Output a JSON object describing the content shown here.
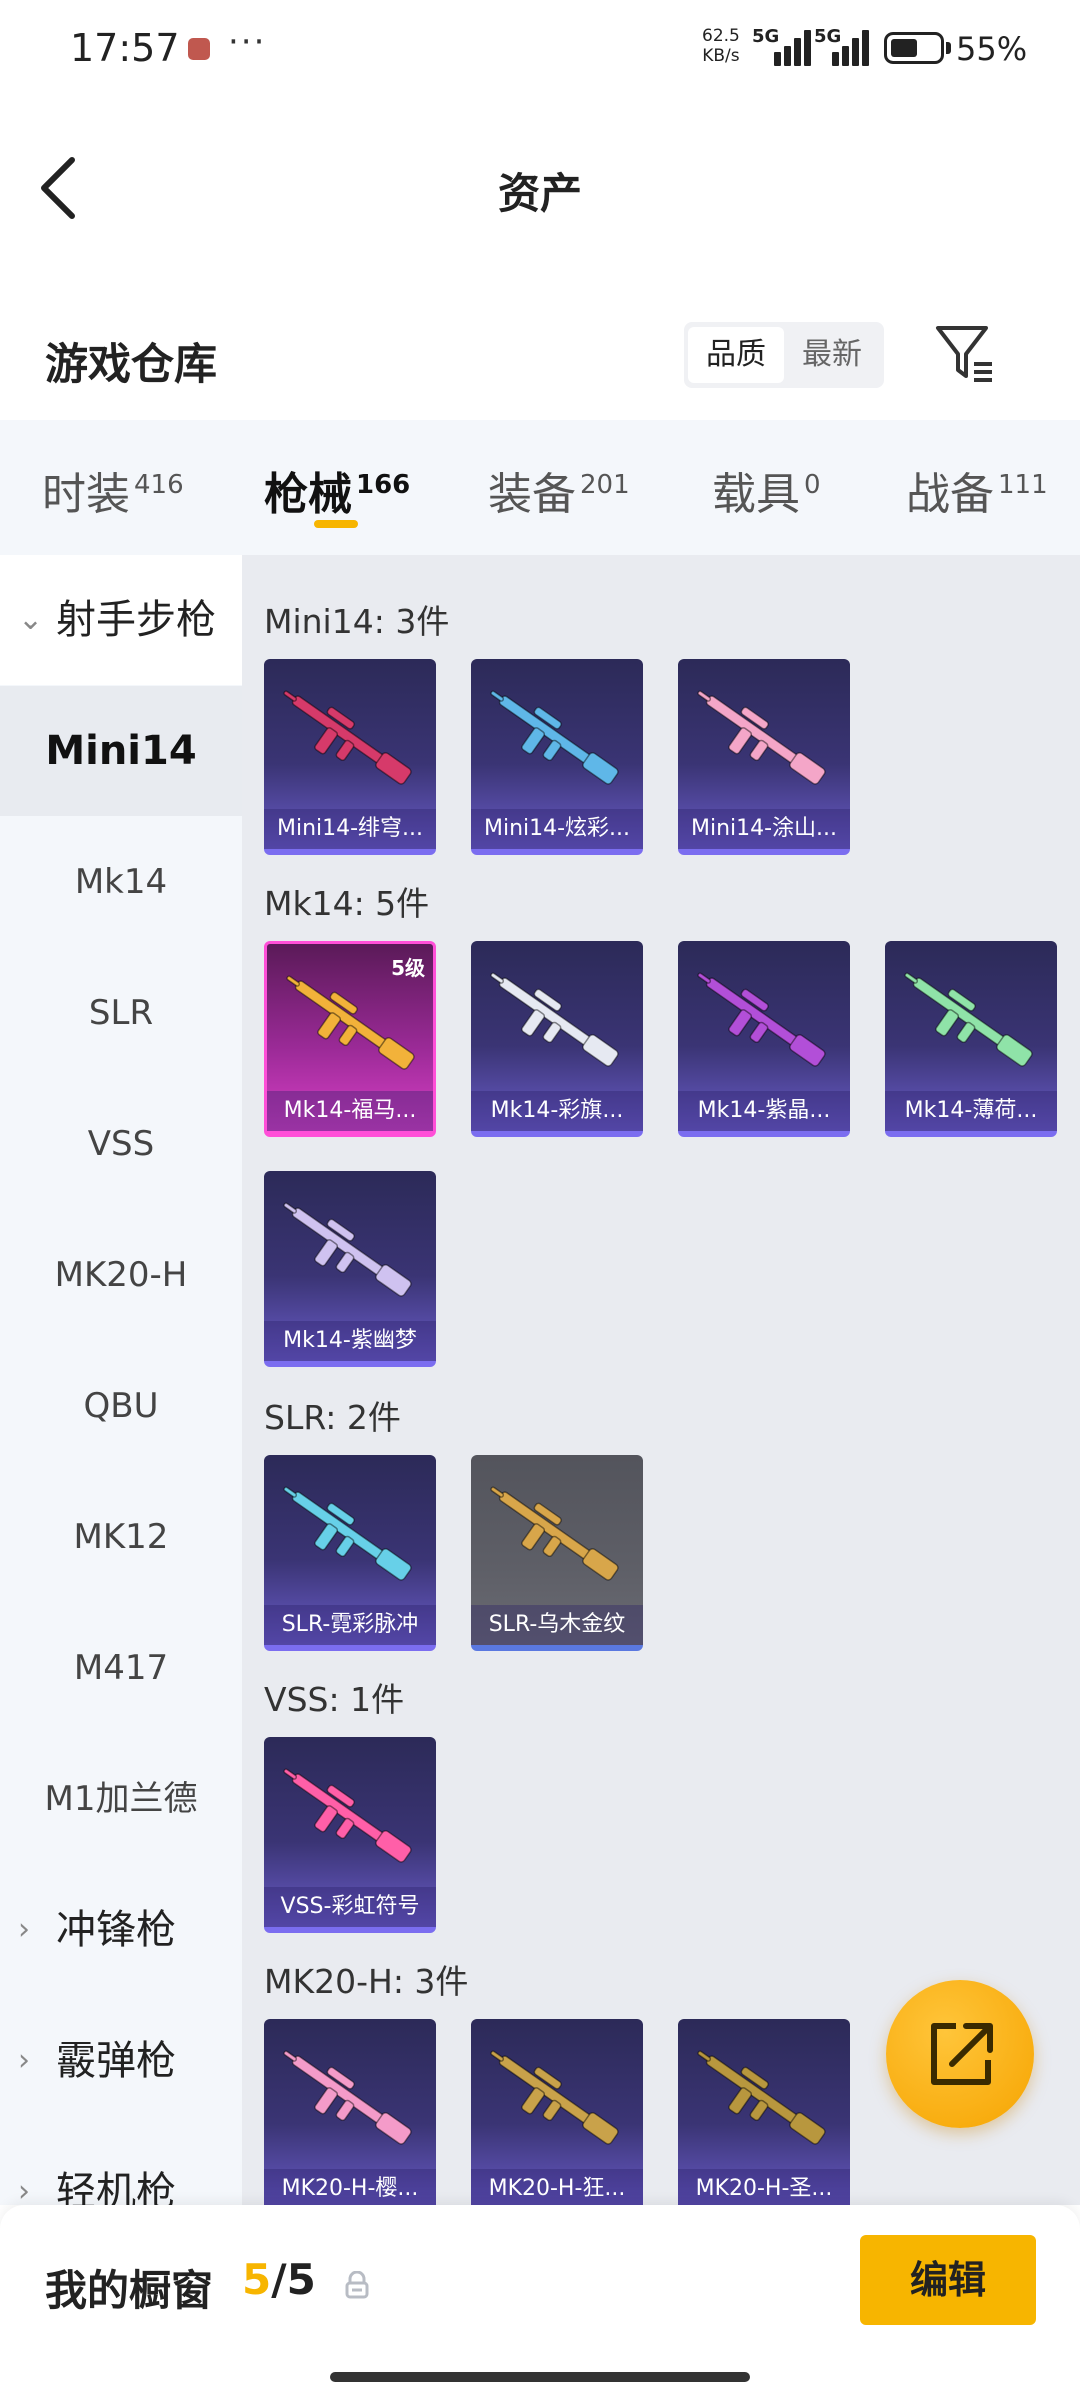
{
  "status_bar": {
    "time": "17:57",
    "dots": "···",
    "speed_value": "62.5",
    "speed_unit": "KB/s",
    "net1": "5G",
    "net2": "5G",
    "battery_pct": "55%",
    "battery_level": 0.55
  },
  "header": {
    "title": "资产"
  },
  "warehouse": {
    "title": "游戏仓库",
    "sort_options": [
      "品质",
      "最新"
    ],
    "active_sort": "品质"
  },
  "tabs": [
    {
      "label": "时装",
      "count": "416"
    },
    {
      "label": "枪械",
      "count": "166",
      "active": true
    },
    {
      "label": "装备",
      "count": "201"
    },
    {
      "label": "载具",
      "count": "0"
    },
    {
      "label": "战备",
      "count": "111"
    }
  ],
  "sidebar": {
    "group_open": "射手步枪",
    "items": [
      "Mini14",
      "Mk14",
      "SLR",
      "VSS",
      "MK20-H",
      "QBU",
      "MK12",
      "M417",
      "M1加兰德"
    ],
    "active_item": "Mini14",
    "groups_collapsed": [
      "冲锋枪",
      "霰弹枪",
      "轻机枪"
    ]
  },
  "sections": [
    {
      "title": "Mini14: 3件",
      "cards": [
        {
          "name": "Mini14-绯穹...",
          "color": "#d63a6a"
        },
        {
          "name": "Mini14-炫彩...",
          "color": "#5fb7e8"
        },
        {
          "name": "Mini14-涂山...",
          "color": "#f4a6c8"
        }
      ]
    },
    {
      "title": "Mk14: 5件",
      "cards": [
        {
          "name": "Mk14-福马...",
          "color": "#f2b23a",
          "level": "5级",
          "style": "pink"
        },
        {
          "name": "Mk14-彩旗...",
          "color": "#e6e9f2"
        },
        {
          "name": "Mk14-紫晶...",
          "color": "#b24fd8"
        },
        {
          "name": "Mk14-薄荷...",
          "color": "#8fe3a8"
        },
        {
          "name": "Mk14-紫幽梦",
          "color": "#cfc2f0"
        }
      ]
    },
    {
      "title": "SLR: 2件",
      "cards": [
        {
          "name": "SLR-霓彩脉冲",
          "color": "#67d0e8"
        },
        {
          "name": "SLR-乌木金纹",
          "color": "#d8a64a",
          "style": "gray"
        }
      ]
    },
    {
      "title": "VSS: 1件",
      "cards": [
        {
          "name": "VSS-彩虹符号",
          "color": "#ff5fa8"
        }
      ]
    },
    {
      "title": "MK20-H: 3件",
      "cards": [
        {
          "name": "MK20-H-樱...",
          "color": "#f49bc9"
        },
        {
          "name": "MK20-H-狂...",
          "color": "#c9a24a"
        },
        {
          "name": "MK20-H-圣...",
          "color": "#b8973e"
        }
      ]
    }
  ],
  "bottom_bar": {
    "label": "我的橱窗",
    "current": "5",
    "separator": "/",
    "total": "5",
    "edit_label": "编辑"
  },
  "colors": {
    "accent": "#f7b500",
    "card_bottom": "#7b6df0",
    "highlight_card": "#ff4fd8"
  }
}
